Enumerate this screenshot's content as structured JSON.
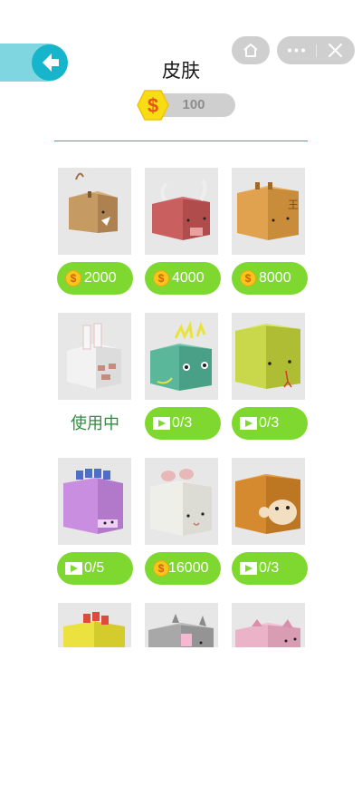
{
  "header": {
    "title": "皮肤",
    "coin_symbol": "$",
    "coin_balance": "100"
  },
  "skins": [
    {
      "animal": "mouse",
      "price": "2000",
      "action": "coin"
    },
    {
      "animal": "ox",
      "price": "4000",
      "action": "coin"
    },
    {
      "animal": "tiger",
      "price": "8000",
      "action": "coin"
    },
    {
      "animal": "rabbit",
      "status": "使用中",
      "action": "in-use"
    },
    {
      "animal": "dragon",
      "progress": "0/3",
      "action": "video"
    },
    {
      "animal": "snake",
      "progress": "0/3",
      "action": "video"
    },
    {
      "animal": "horse",
      "progress": "0/5",
      "action": "video"
    },
    {
      "animal": "sheep",
      "price": "16000",
      "action": "coin"
    },
    {
      "animal": "monkey",
      "progress": "0/3",
      "action": "video"
    },
    {
      "animal": "rooster"
    },
    {
      "animal": "dog"
    },
    {
      "animal": "pig"
    }
  ],
  "icons": {
    "back": "arrow-left-icon",
    "home": "home-icon",
    "more": "more-dots-icon",
    "close": "close-icon",
    "coin": "dollar-coin-icon",
    "video": "play-video-icon"
  },
  "colors": {
    "accent_green": "#7ed82f",
    "back_teal": "#17b5cc",
    "divider_pink": "#e6557b",
    "in_use_green": "#2f8f3e"
  }
}
